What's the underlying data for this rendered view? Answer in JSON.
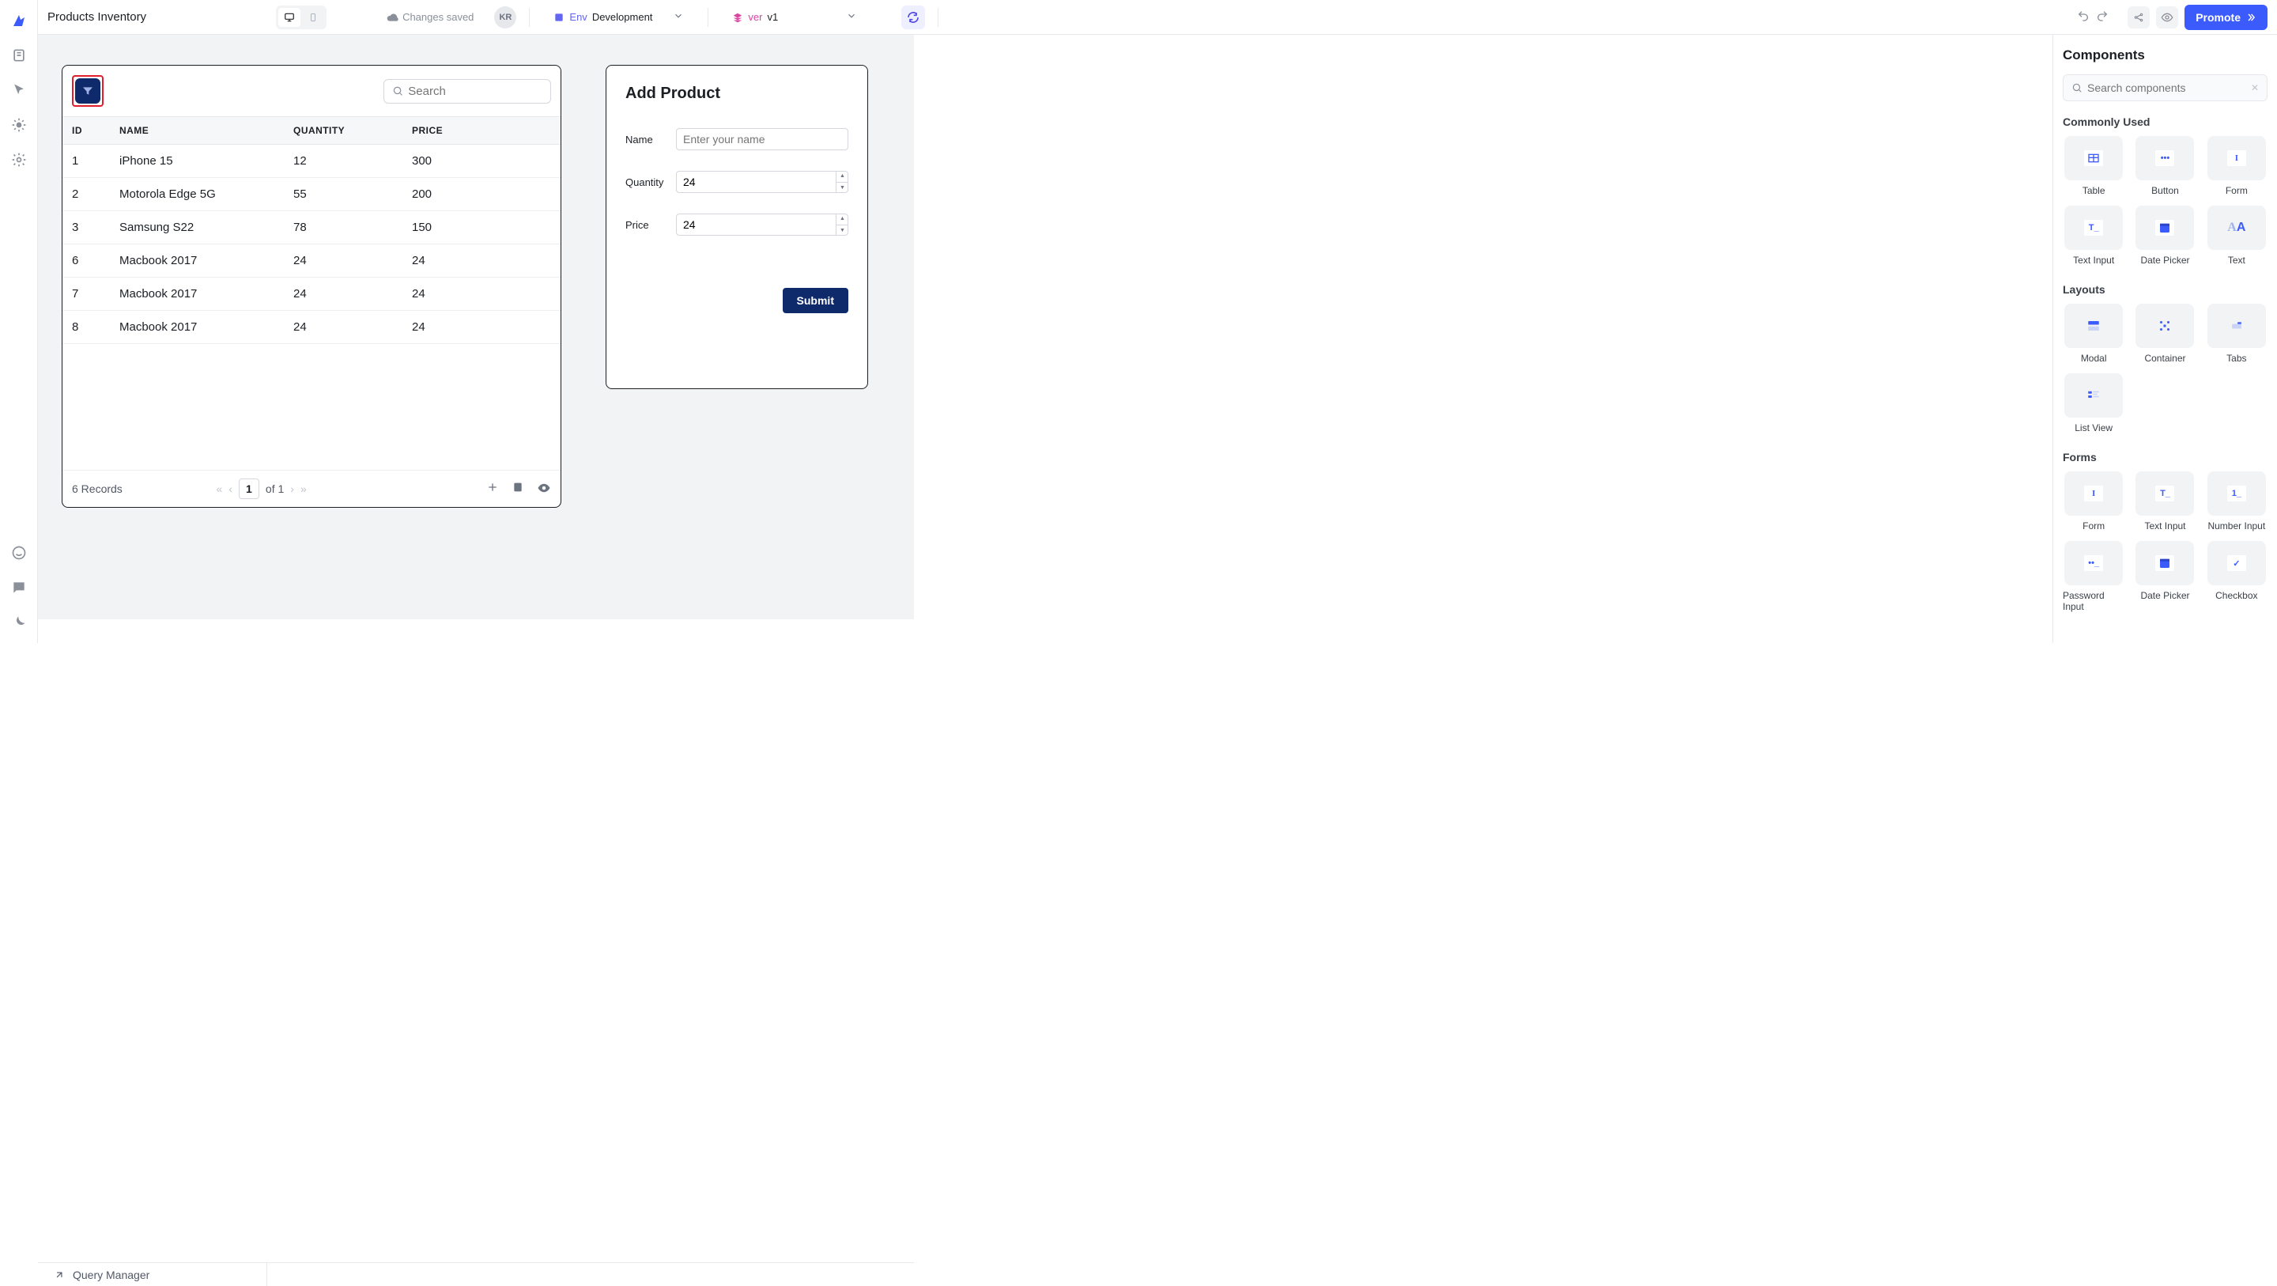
{
  "app": {
    "title": "Products Inventory"
  },
  "topbar": {
    "saved_text": "Changes saved",
    "user_initials": "KR",
    "env_prefix": "Env",
    "env_value": "Development",
    "ver_prefix": "ver",
    "ver_value": "v1",
    "promote_label": "Promote"
  },
  "table": {
    "search_placeholder": "Search",
    "columns": [
      "ID",
      "NAME",
      "QUANTITY",
      "PRICE"
    ],
    "rows": [
      {
        "id": "1",
        "name": "iPhone 15",
        "qty": "12",
        "price": "300"
      },
      {
        "id": "2",
        "name": "Motorola Edge 5G",
        "qty": "55",
        "price": "200"
      },
      {
        "id": "3",
        "name": "Samsung S22",
        "qty": "78",
        "price": "150"
      },
      {
        "id": "6",
        "name": "Macbook 2017",
        "qty": "24",
        "price": "24"
      },
      {
        "id": "7",
        "name": "Macbook 2017",
        "qty": "24",
        "price": "24"
      },
      {
        "id": "8",
        "name": "Macbook 2017",
        "qty": "24",
        "price": "24"
      }
    ],
    "records_text": "6 Records",
    "page_current": "1",
    "page_total_text": "of 1"
  },
  "form": {
    "title": "Add Product",
    "name_label": "Name",
    "name_placeholder": "Enter your name",
    "qty_label": "Quantity",
    "qty_value": "24",
    "price_label": "Price",
    "price_value": "24",
    "submit_label": "Submit"
  },
  "bottombar": {
    "query_manager": "Query Manager"
  },
  "components_panel": {
    "title": "Components",
    "search_placeholder": "Search components",
    "sections": {
      "commonly_used": {
        "label": "Commonly Used",
        "items": [
          "Table",
          "Button",
          "Form",
          "Text Input",
          "Date Picker",
          "Text"
        ]
      },
      "layouts": {
        "label": "Layouts",
        "items": [
          "Modal",
          "Container",
          "Tabs",
          "List View"
        ]
      },
      "forms": {
        "label": "Forms",
        "items": [
          "Form",
          "Text Input",
          "Number Input",
          "Password Input",
          "Date Picker",
          "Checkbox"
        ]
      }
    }
  }
}
